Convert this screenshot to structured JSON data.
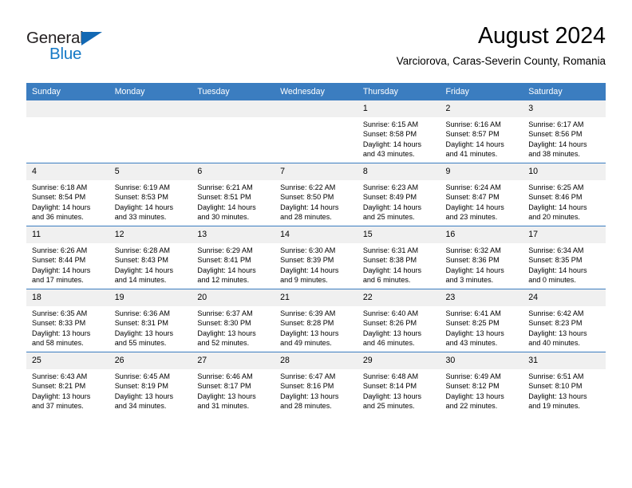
{
  "brand": {
    "name_part1": "General",
    "name_part2": "Blue"
  },
  "header": {
    "title": "August 2024",
    "subtitle": "Varciorova, Caras-Severin County, Romania"
  },
  "colors": {
    "header_blue": "#3b7dc0",
    "daynum_gray": "#f0f0f0",
    "brand_blue": "#1579c6",
    "brand_dark": "#231f20"
  },
  "weekdays": [
    "Sunday",
    "Monday",
    "Tuesday",
    "Wednesday",
    "Thursday",
    "Friday",
    "Saturday"
  ],
  "labels": {
    "sunrise_prefix": "Sunrise:",
    "sunset_prefix": "Sunset:",
    "daylight_prefix": "Daylight:"
  },
  "weeks": [
    [
      {
        "day": "",
        "blank": true,
        "line1": "",
        "line2": "",
        "line3": "",
        "line4": ""
      },
      {
        "day": "",
        "blank": true,
        "line1": "",
        "line2": "",
        "line3": "",
        "line4": ""
      },
      {
        "day": "",
        "blank": true,
        "line1": "",
        "line2": "",
        "line3": "",
        "line4": ""
      },
      {
        "day": "",
        "blank": true,
        "line1": "",
        "line2": "",
        "line3": "",
        "line4": ""
      },
      {
        "day": "1",
        "blank": false,
        "line1": "Sunrise: 6:15 AM",
        "line2": "Sunset: 8:58 PM",
        "line3": "Daylight: 14 hours",
        "line4": "and 43 minutes."
      },
      {
        "day": "2",
        "blank": false,
        "line1": "Sunrise: 6:16 AM",
        "line2": "Sunset: 8:57 PM",
        "line3": "Daylight: 14 hours",
        "line4": "and 41 minutes."
      },
      {
        "day": "3",
        "blank": false,
        "line1": "Sunrise: 6:17 AM",
        "line2": "Sunset: 8:56 PM",
        "line3": "Daylight: 14 hours",
        "line4": "and 38 minutes."
      }
    ],
    [
      {
        "day": "4",
        "blank": false,
        "line1": "Sunrise: 6:18 AM",
        "line2": "Sunset: 8:54 PM",
        "line3": "Daylight: 14 hours",
        "line4": "and 36 minutes."
      },
      {
        "day": "5",
        "blank": false,
        "line1": "Sunrise: 6:19 AM",
        "line2": "Sunset: 8:53 PM",
        "line3": "Daylight: 14 hours",
        "line4": "and 33 minutes."
      },
      {
        "day": "6",
        "blank": false,
        "line1": "Sunrise: 6:21 AM",
        "line2": "Sunset: 8:51 PM",
        "line3": "Daylight: 14 hours",
        "line4": "and 30 minutes."
      },
      {
        "day": "7",
        "blank": false,
        "line1": "Sunrise: 6:22 AM",
        "line2": "Sunset: 8:50 PM",
        "line3": "Daylight: 14 hours",
        "line4": "and 28 minutes."
      },
      {
        "day": "8",
        "blank": false,
        "line1": "Sunrise: 6:23 AM",
        "line2": "Sunset: 8:49 PM",
        "line3": "Daylight: 14 hours",
        "line4": "and 25 minutes."
      },
      {
        "day": "9",
        "blank": false,
        "line1": "Sunrise: 6:24 AM",
        "line2": "Sunset: 8:47 PM",
        "line3": "Daylight: 14 hours",
        "line4": "and 23 minutes."
      },
      {
        "day": "10",
        "blank": false,
        "line1": "Sunrise: 6:25 AM",
        "line2": "Sunset: 8:46 PM",
        "line3": "Daylight: 14 hours",
        "line4": "and 20 minutes."
      }
    ],
    [
      {
        "day": "11",
        "blank": false,
        "line1": "Sunrise: 6:26 AM",
        "line2": "Sunset: 8:44 PM",
        "line3": "Daylight: 14 hours",
        "line4": "and 17 minutes."
      },
      {
        "day": "12",
        "blank": false,
        "line1": "Sunrise: 6:28 AM",
        "line2": "Sunset: 8:43 PM",
        "line3": "Daylight: 14 hours",
        "line4": "and 14 minutes."
      },
      {
        "day": "13",
        "blank": false,
        "line1": "Sunrise: 6:29 AM",
        "line2": "Sunset: 8:41 PM",
        "line3": "Daylight: 14 hours",
        "line4": "and 12 minutes."
      },
      {
        "day": "14",
        "blank": false,
        "line1": "Sunrise: 6:30 AM",
        "line2": "Sunset: 8:39 PM",
        "line3": "Daylight: 14 hours",
        "line4": "and 9 minutes."
      },
      {
        "day": "15",
        "blank": false,
        "line1": "Sunrise: 6:31 AM",
        "line2": "Sunset: 8:38 PM",
        "line3": "Daylight: 14 hours",
        "line4": "and 6 minutes."
      },
      {
        "day": "16",
        "blank": false,
        "line1": "Sunrise: 6:32 AM",
        "line2": "Sunset: 8:36 PM",
        "line3": "Daylight: 14 hours",
        "line4": "and 3 minutes."
      },
      {
        "day": "17",
        "blank": false,
        "line1": "Sunrise: 6:34 AM",
        "line2": "Sunset: 8:35 PM",
        "line3": "Daylight: 14 hours",
        "line4": "and 0 minutes."
      }
    ],
    [
      {
        "day": "18",
        "blank": false,
        "line1": "Sunrise: 6:35 AM",
        "line2": "Sunset: 8:33 PM",
        "line3": "Daylight: 13 hours",
        "line4": "and 58 minutes."
      },
      {
        "day": "19",
        "blank": false,
        "line1": "Sunrise: 6:36 AM",
        "line2": "Sunset: 8:31 PM",
        "line3": "Daylight: 13 hours",
        "line4": "and 55 minutes."
      },
      {
        "day": "20",
        "blank": false,
        "line1": "Sunrise: 6:37 AM",
        "line2": "Sunset: 8:30 PM",
        "line3": "Daylight: 13 hours",
        "line4": "and 52 minutes."
      },
      {
        "day": "21",
        "blank": false,
        "line1": "Sunrise: 6:39 AM",
        "line2": "Sunset: 8:28 PM",
        "line3": "Daylight: 13 hours",
        "line4": "and 49 minutes."
      },
      {
        "day": "22",
        "blank": false,
        "line1": "Sunrise: 6:40 AM",
        "line2": "Sunset: 8:26 PM",
        "line3": "Daylight: 13 hours",
        "line4": "and 46 minutes."
      },
      {
        "day": "23",
        "blank": false,
        "line1": "Sunrise: 6:41 AM",
        "line2": "Sunset: 8:25 PM",
        "line3": "Daylight: 13 hours",
        "line4": "and 43 minutes."
      },
      {
        "day": "24",
        "blank": false,
        "line1": "Sunrise: 6:42 AM",
        "line2": "Sunset: 8:23 PM",
        "line3": "Daylight: 13 hours",
        "line4": "and 40 minutes."
      }
    ],
    [
      {
        "day": "25",
        "blank": false,
        "line1": "Sunrise: 6:43 AM",
        "line2": "Sunset: 8:21 PM",
        "line3": "Daylight: 13 hours",
        "line4": "and 37 minutes."
      },
      {
        "day": "26",
        "blank": false,
        "line1": "Sunrise: 6:45 AM",
        "line2": "Sunset: 8:19 PM",
        "line3": "Daylight: 13 hours",
        "line4": "and 34 minutes."
      },
      {
        "day": "27",
        "blank": false,
        "line1": "Sunrise: 6:46 AM",
        "line2": "Sunset: 8:17 PM",
        "line3": "Daylight: 13 hours",
        "line4": "and 31 minutes."
      },
      {
        "day": "28",
        "blank": false,
        "line1": "Sunrise: 6:47 AM",
        "line2": "Sunset: 8:16 PM",
        "line3": "Daylight: 13 hours",
        "line4": "and 28 minutes."
      },
      {
        "day": "29",
        "blank": false,
        "line1": "Sunrise: 6:48 AM",
        "line2": "Sunset: 8:14 PM",
        "line3": "Daylight: 13 hours",
        "line4": "and 25 minutes."
      },
      {
        "day": "30",
        "blank": false,
        "line1": "Sunrise: 6:49 AM",
        "line2": "Sunset: 8:12 PM",
        "line3": "Daylight: 13 hours",
        "line4": "and 22 minutes."
      },
      {
        "day": "31",
        "blank": false,
        "line1": "Sunrise: 6:51 AM",
        "line2": "Sunset: 8:10 PM",
        "line3": "Daylight: 13 hours",
        "line4": "and 19 minutes."
      }
    ]
  ]
}
